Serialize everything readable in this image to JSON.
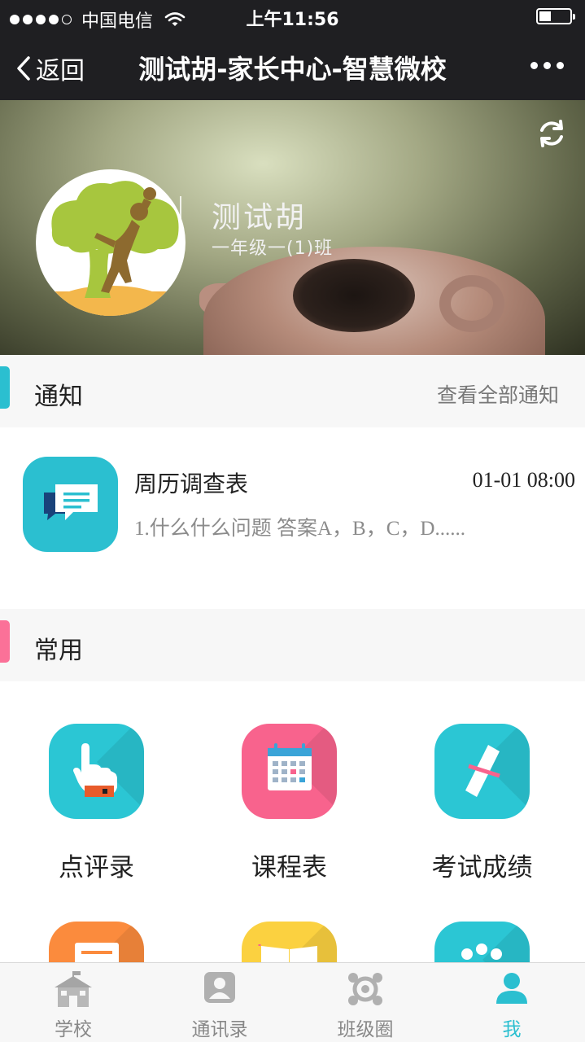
{
  "status_bar": {
    "carrier": "中国电信",
    "time": "上午11:56"
  },
  "nav": {
    "back_label": "返回",
    "title": "测试胡-家长中心-智慧微校"
  },
  "profile": {
    "name": "测试胡",
    "class": "一年级一(1)班"
  },
  "notice_section": {
    "title": "通知",
    "view_all": "查看全部通知",
    "bar_color": "#2bbfd0",
    "items": [
      {
        "title": "周历调查表",
        "time": "01-01 08:00",
        "desc": "1.什么什么问题 答案A，B，C，D......"
      }
    ]
  },
  "common_section": {
    "title": "常用",
    "bar_color": "#fb7198",
    "apps": [
      {
        "label": "点评录",
        "icon": "pointing-hand-icon",
        "color": "#2bc6d4"
      },
      {
        "label": "课程表",
        "icon": "calendar-icon",
        "color": "#f8638d"
      },
      {
        "label": "考试成绩",
        "icon": "certificate-scroll-icon",
        "color": "#2bc6d4"
      },
      {
        "label": "",
        "icon": "leave-request-icon",
        "color": "#fb8b3d"
      },
      {
        "label": "",
        "icon": "open-book-icon",
        "color": "#fbd140"
      },
      {
        "label": "",
        "icon": "group-dots-icon",
        "color": "#2bc6d4"
      }
    ]
  },
  "tab_bar": {
    "active_color": "#2bbfd0",
    "tabs": [
      {
        "label": "学校",
        "icon": "school-icon"
      },
      {
        "label": "通讯录",
        "icon": "contacts-icon"
      },
      {
        "label": "班级圈",
        "icon": "class-circle-icon"
      },
      {
        "label": "我",
        "icon": "person-icon",
        "active": true
      }
    ]
  }
}
